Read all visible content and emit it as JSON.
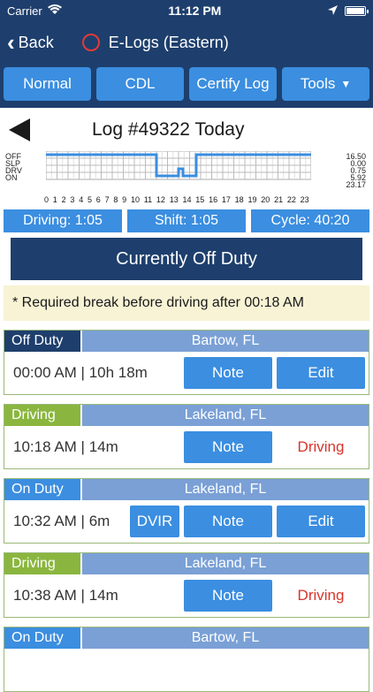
{
  "status_bar": {
    "carrier": "Carrier",
    "time": "11:12 PM"
  },
  "nav": {
    "back_label": "Back",
    "title": "E-Logs (Eastern)"
  },
  "tabs": [
    {
      "label": "Normal"
    },
    {
      "label": "CDL"
    },
    {
      "label": "Certify Log"
    },
    {
      "label": "Tools",
      "has_dropdown": true
    }
  ],
  "log": {
    "title": "Log #49322 Today"
  },
  "graph": {
    "rows": [
      "OFF",
      "SLP",
      "DRV",
      "ON"
    ],
    "totals": [
      "16.50",
      "0.00",
      "0.75",
      "5.92",
      "23.17"
    ],
    "hours": [
      "0",
      "1",
      "2",
      "3",
      "4",
      "5",
      "6",
      "7",
      "8",
      "9",
      "10",
      "11",
      "12",
      "13",
      "14",
      "15",
      "16",
      "17",
      "18",
      "19",
      "20",
      "21",
      "22",
      "23"
    ]
  },
  "summary": {
    "driving": "Driving: 1:05",
    "shift": "Shift: 1:05",
    "cycle": "Cycle: 40:20"
  },
  "banner": "Currently Off Duty",
  "notice": "* Required break before driving after 00:18 AM",
  "entries": [
    {
      "status": "Off Duty",
      "location": "Bartow, FL",
      "time": "00:00 AM | 10h 18m",
      "note": "Note",
      "edit": "Edit"
    },
    {
      "status": "Driving",
      "location": "Lakeland, FL",
      "time": "10:18 AM | 14m",
      "note": "Note",
      "driving": "Driving"
    },
    {
      "status": "On Duty",
      "location": "Lakeland, FL",
      "time": "10:32 AM | 6m",
      "dvir": "DVIR",
      "note": "Note",
      "edit": "Edit"
    },
    {
      "status": "Driving",
      "location": "Lakeland, FL",
      "time": "10:38 AM | 14m",
      "note": "Note",
      "driving": "Driving"
    },
    {
      "status": "On Duty",
      "location": "Bartow, FL"
    }
  ],
  "colors": {
    "navy": "#1e3f6d",
    "blue": "#3b8ee0",
    "green": "#8ab63f",
    "red": "#d9342b"
  }
}
